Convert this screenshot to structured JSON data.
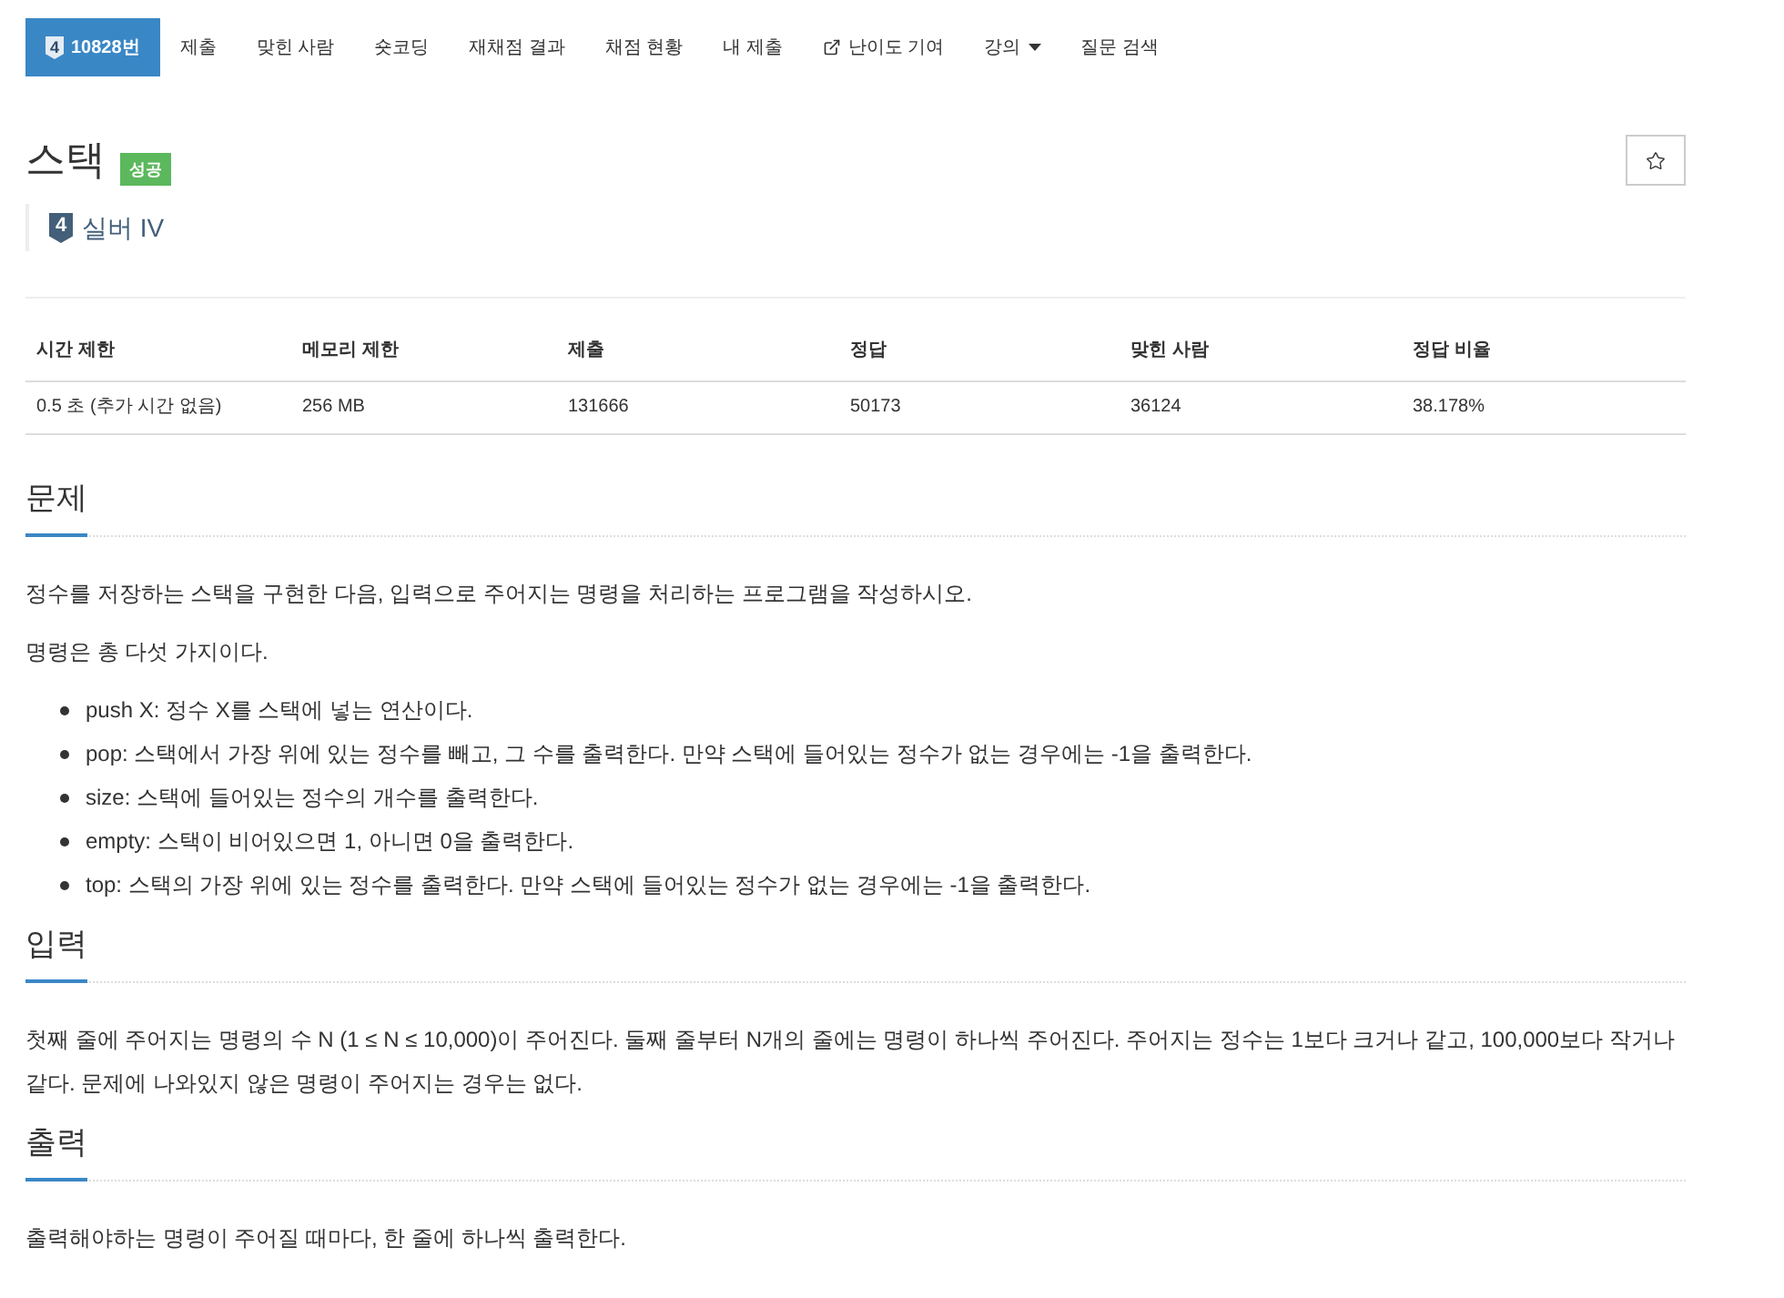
{
  "nav": {
    "items": [
      {
        "label": "10828번",
        "kind": "problem",
        "tier": "4",
        "selected": true
      },
      {
        "label": "제출",
        "kind": "link",
        "selected": false
      },
      {
        "label": "맞힌 사람",
        "kind": "link",
        "selected": false
      },
      {
        "label": "숏코딩",
        "kind": "link",
        "selected": false
      },
      {
        "label": "재채점 결과",
        "kind": "link",
        "selected": false
      },
      {
        "label": "채점 현황",
        "kind": "link",
        "selected": false
      },
      {
        "label": "내 제출",
        "kind": "link",
        "selected": false
      },
      {
        "label": "난이도 기여",
        "kind": "external",
        "selected": false
      },
      {
        "label": "강의",
        "kind": "dropdown",
        "selected": false
      },
      {
        "label": "질문 검색",
        "kind": "link",
        "selected": false
      }
    ]
  },
  "problem": {
    "title": "스택",
    "result_badge": "성공",
    "tier": {
      "number": "4",
      "name": "실버 IV"
    }
  },
  "info_table": {
    "columns": [
      "시간 제한",
      "메모리 제한",
      "제출",
      "정답",
      "맞힌 사람",
      "정답 비율"
    ],
    "rows": [
      [
        "0.5 초 (추가 시간 없음)",
        "256 MB",
        "131666",
        "50173",
        "36124",
        "38.178%"
      ]
    ]
  },
  "sections": [
    {
      "heading": "문제",
      "blocks": [
        {
          "kind": "paragraph",
          "text": "정수를 저장하는 스택을 구현한 다음, 입력으로 주어지는 명령을 처리하는 프로그램을 작성하시오."
        },
        {
          "kind": "paragraph",
          "text": "명령은 총 다섯 가지이다."
        },
        {
          "kind": "list",
          "items": [
            "push X: 정수 X를 스택에 넣는 연산이다.",
            "pop: 스택에서 가장 위에 있는 정수를 빼고, 그 수를 출력한다. 만약 스택에 들어있는 정수가 없는 경우에는 -1을 출력한다.",
            "size: 스택에 들어있는 정수의 개수를 출력한다.",
            "empty: 스택이 비어있으면 1, 아니면 0을 출력한다.",
            "top: 스택의 가장 위에 있는 정수를 출력한다. 만약 스택에 들어있는 정수가 없는 경우에는 -1을 출력한다."
          ]
        }
      ]
    },
    {
      "heading": "입력",
      "blocks": [
        {
          "kind": "paragraph",
          "text": "첫째 줄에 주어지는 명령의 수 N (1 ≤ N ≤ 10,000)이 주어진다. 둘째 줄부터 N개의 줄에는 명령이 하나씩 주어진다. 주어지는 정수는 1보다 크거나 같고, 100,000보다 작거나 같다. 문제에 나와있지 않은 명령이 주어지는 경우는 없다."
        }
      ]
    },
    {
      "heading": "출력",
      "blocks": [
        {
          "kind": "paragraph",
          "text": "출력해야하는 명령이 주어질 때마다, 한 줄에 하나씩 출력한다."
        }
      ]
    }
  ]
}
